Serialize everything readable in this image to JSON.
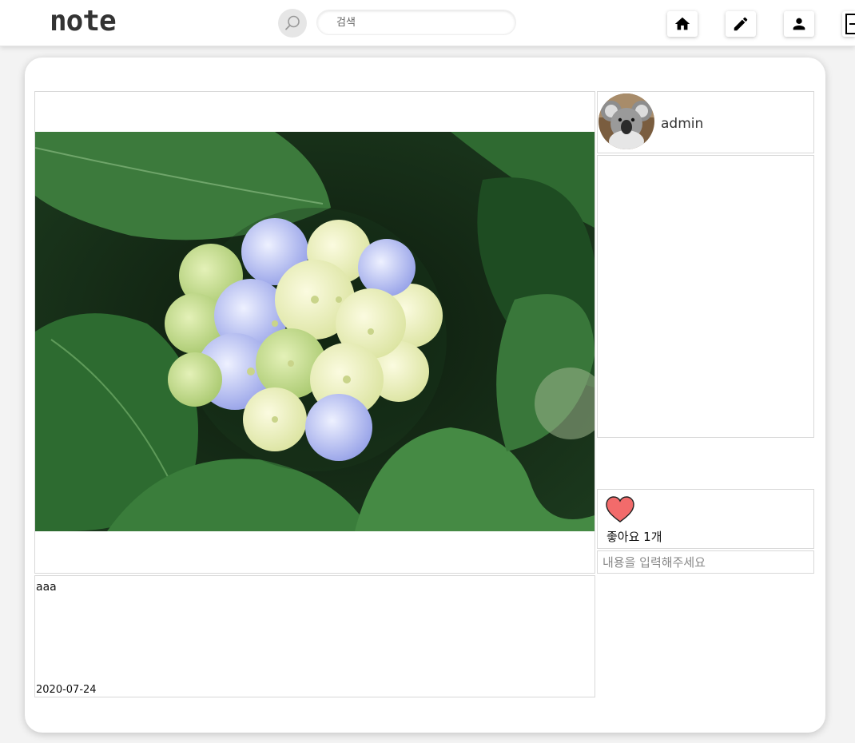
{
  "header": {
    "logo": "note",
    "search_placeholder": "검색",
    "nav": [
      {
        "name": "home-icon"
      },
      {
        "name": "pencil-icon"
      },
      {
        "name": "user-icon"
      },
      {
        "name": "logout-icon"
      }
    ]
  },
  "post": {
    "image": {
      "name": "hydrangea-photo"
    },
    "author": {
      "name": "admin",
      "avatar": "koala-avatar"
    },
    "likes_label": "좋아요 1개",
    "comment_placeholder": "내용을 입력해주세요",
    "content": "aaa",
    "date": "2020-07-24"
  },
  "colors": {
    "heart": "#f26b6b",
    "border": "#d8d8d8",
    "background": "#f3f3f3"
  }
}
